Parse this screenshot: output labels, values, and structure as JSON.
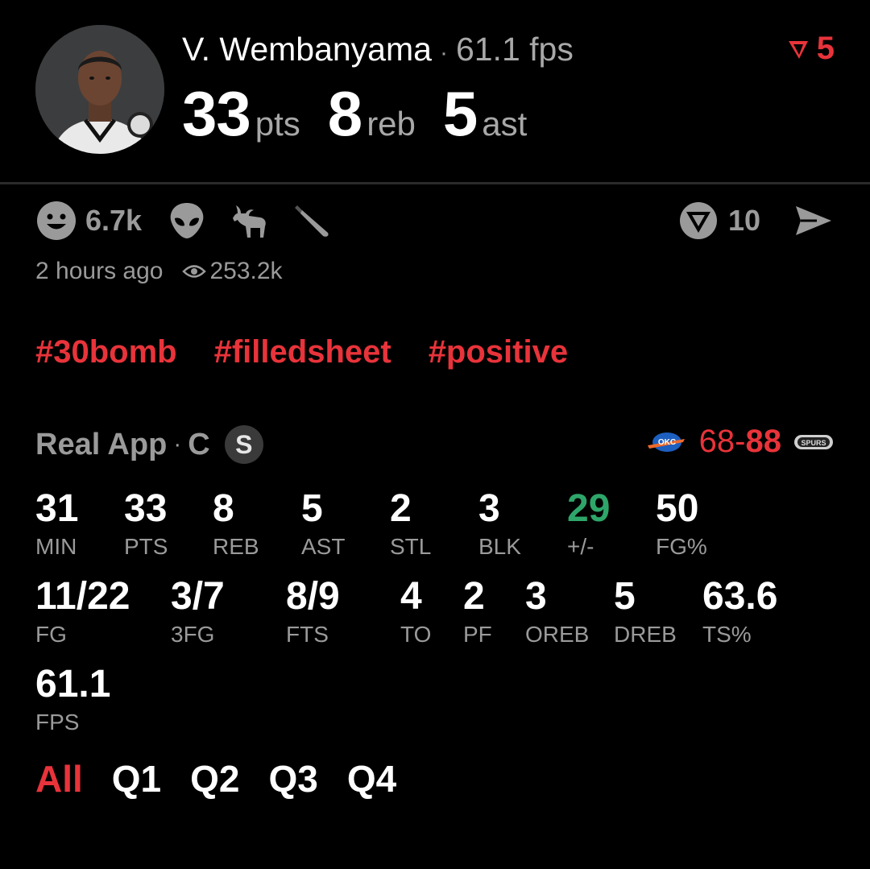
{
  "player": {
    "name": "V. Wembanyama",
    "separator": "·",
    "fps_text": "61.1 fps",
    "avatar": "player-headshot"
  },
  "flag": {
    "icon": "flag-icon",
    "count": "5",
    "color": "#e8333a"
  },
  "headline": {
    "pts_value": "33",
    "pts_unit": "pts",
    "reb_value": "8",
    "reb_unit": "reb",
    "ast_value": "5",
    "ast_unit": "ast"
  },
  "reactions": {
    "smile_icon": "smile-icon",
    "smile_count": "6.7k",
    "alien_icon": "alien-icon",
    "goat_icon": "goat-icon",
    "knife_icon": "knife-icon"
  },
  "actions": {
    "vote_icon": "real-logo-icon",
    "vote_count": "10",
    "share_icon": "send-icon"
  },
  "meta": {
    "time_ago": "2 hours ago",
    "eye_icon": "eye-icon",
    "views": "253.2k"
  },
  "tags": [
    "#30bomb",
    "#filledsheet",
    "#positive"
  ],
  "source": {
    "app": "Real App",
    "separator": "·",
    "position": "C",
    "badge": "S"
  },
  "game": {
    "away_logo": "okc-logo-icon",
    "away_score": "68",
    "dash": "-",
    "home_score": "88",
    "home_logo": "spurs-logo-icon"
  },
  "stats_row1": [
    {
      "value": "31",
      "label": "MIN"
    },
    {
      "value": "33",
      "label": "PTS"
    },
    {
      "value": "8",
      "label": "REB"
    },
    {
      "value": "5",
      "label": "AST"
    },
    {
      "value": "2",
      "label": "STL"
    },
    {
      "value": "3",
      "label": "BLK"
    },
    {
      "value": "29",
      "label": "+/-"
    },
    {
      "value": "50",
      "label": "FG%"
    }
  ],
  "stats_row2": [
    {
      "value": "11/22",
      "label": "FG"
    },
    {
      "value": "3/7",
      "label": "3FG"
    },
    {
      "value": "8/9",
      "label": "FTS"
    },
    {
      "value": "4",
      "label": "TO"
    },
    {
      "value": "2",
      "label": "PF"
    },
    {
      "value": "3",
      "label": "OREB"
    },
    {
      "value": "5",
      "label": "DREB"
    },
    {
      "value": "63.6",
      "label": "TS%"
    }
  ],
  "stats_row3": [
    {
      "value": "61.1",
      "label": "FPS"
    }
  ],
  "periods": [
    "All",
    "Q1",
    "Q2",
    "Q3",
    "Q4"
  ],
  "colors": {
    "accent": "#e8333a",
    "positive": "#2ea66a",
    "muted": "#9a9a9a"
  }
}
